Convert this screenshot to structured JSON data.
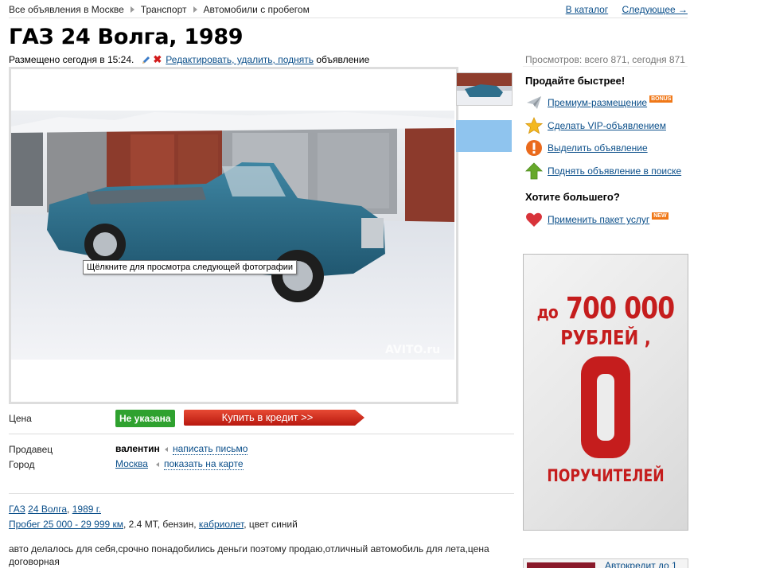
{
  "breadcrumb": [
    "Все объявления в Москве",
    "Транспорт",
    "Автомобили с пробегом"
  ],
  "topnav": {
    "catalog": "В каталог",
    "next": "Следующее →"
  },
  "title": "ГАЗ 24 Волга, 1989",
  "posted": {
    "text": "Размещено сегодня в 15:24.",
    "edit_link": "Редактировать, удалить, поднять",
    "suffix": "объявление"
  },
  "views": "Просмотров: всего 871, сегодня 871",
  "photo": {
    "tooltip": "Щёлкните для просмотра следующей фотографии",
    "watermark": "AVITO.ru"
  },
  "price": {
    "label": "Цена",
    "value": "Не указана",
    "credit_button": "Купить в кредит >>"
  },
  "seller": {
    "label": "Продавец",
    "name": "валентин",
    "action": "написать письмо"
  },
  "city": {
    "label": "Город",
    "name": "Москва",
    "action": "показать на карте"
  },
  "details": {
    "make": "ГАЗ",
    "model": "24 Волга",
    "year": "1989 г.",
    "mileage": "Пробег 25 000 - 29 999 км",
    "engine": "2.4 МТ",
    "fuel": "бензин",
    "body": "кабриолет",
    "color": "цвет синий"
  },
  "description_line1": "авто делалось для себя,срочно понадобились деньги поэтому продаю,отличный автомобиль для лета,цена",
  "description_line2": "договорная",
  "sell_faster": {
    "title": "Продайте быстрее!",
    "items": [
      {
        "label": "Премиум-размещение",
        "badge": "BONUS",
        "icon": "paper-plane-icon"
      },
      {
        "label": "Сделать VIP-объявлением",
        "icon": "star-icon"
      },
      {
        "label": "Выделить объявление",
        "icon": "exclamation-icon"
      },
      {
        "label": "Поднять объявление в поиске",
        "icon": "up-arrow-icon"
      }
    ]
  },
  "want_more": {
    "title": "Хотите большего?",
    "item": "Применить пакет услуг",
    "badge": "NEW",
    "icon": "heart-icon"
  },
  "banner": {
    "line1_prefix": "до",
    "line1_amount": "700 000",
    "line2": "РУБЛЕЙ ,",
    "line3": "ПОРУЧИТЕЛЕЙ"
  },
  "bottom_banner": {
    "link": "Автокредит до 1"
  },
  "colors": {
    "link": "#0b4f8a",
    "price_badge": "#2fa12f",
    "credit_button": "#d42a1c",
    "banner_red": "#c51d1d"
  }
}
